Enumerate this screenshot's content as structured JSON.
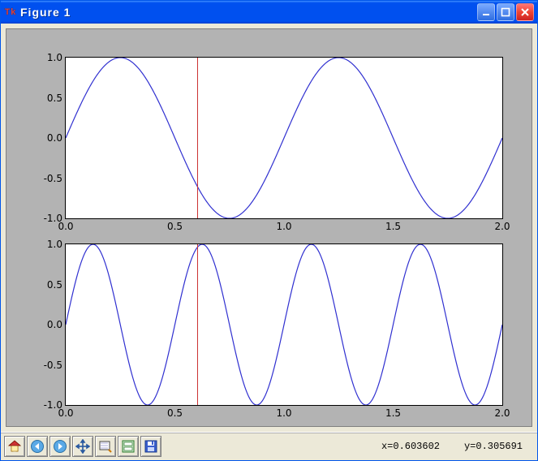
{
  "window": {
    "title": "Figure 1",
    "icon": "tk-icon"
  },
  "toolbar": {
    "home": "home-icon",
    "back": "back-icon",
    "forward": "forward-icon",
    "pan": "pan-icon",
    "zoom": "zoom-icon",
    "subplots": "subplots-icon",
    "save": "save-icon"
  },
  "status": {
    "x_label": "x=0.603602",
    "y_label": "y=0.305691"
  },
  "plots": {
    "top": {
      "id": "top-plot",
      "y_ticks": [
        "1.0",
        "0.5",
        "0.0",
        "-0.5",
        "-1.0"
      ],
      "x_ticks": [
        "0.0",
        "0.5",
        "1.0",
        "1.5",
        "2.0"
      ]
    },
    "bottom": {
      "id": "bottom-plot",
      "y_ticks": [
        "1.0",
        "0.5",
        "0.0",
        "-0.5",
        "-1.0"
      ],
      "x_ticks": [
        "0.0",
        "0.5",
        "1.0",
        "1.5",
        "2.0"
      ]
    }
  },
  "chart_data": [
    {
      "type": "line",
      "id": "top-plot",
      "title": "",
      "xlabel": "",
      "ylabel": "",
      "xlim": [
        0.0,
        2.0
      ],
      "ylim": [
        -1.0,
        1.0
      ],
      "series": [
        {
          "name": "sin(2πx)",
          "function": "sin(2*pi*x)",
          "xrange": [
            0.0,
            2.0
          ],
          "samples": 400,
          "color": "#3030d0"
        }
      ],
      "annotations": [
        {
          "type": "vline",
          "x": 0.603602,
          "color": "#cc3333"
        }
      ]
    },
    {
      "type": "line",
      "id": "bottom-plot",
      "title": "",
      "xlabel": "",
      "ylabel": "",
      "xlim": [
        0.0,
        2.0
      ],
      "ylim": [
        -1.0,
        1.0
      ],
      "series": [
        {
          "name": "sin(4πx)",
          "function": "sin(4*pi*x)",
          "xrange": [
            0.0,
            2.0
          ],
          "samples": 400,
          "color": "#3030d0"
        }
      ],
      "annotations": [
        {
          "type": "vline",
          "x": 0.603602,
          "color": "#cc3333"
        }
      ]
    }
  ]
}
